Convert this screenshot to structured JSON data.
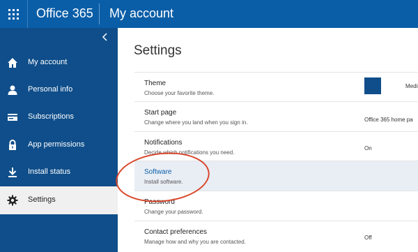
{
  "topbar": {
    "brand": "Office 365",
    "page": "My account",
    "accent": "#0a5ea8"
  },
  "sidebar": {
    "collapse_icon": "chevron-left-icon",
    "items": [
      {
        "label": "My account",
        "icon": "home-icon"
      },
      {
        "label": "Personal info",
        "icon": "person-icon"
      },
      {
        "label": "Subscriptions",
        "icon": "card-icon"
      },
      {
        "label": "App permissions",
        "icon": "lock-icon"
      },
      {
        "label": "Install status",
        "icon": "download-icon"
      },
      {
        "label": "Settings",
        "icon": "gear-icon",
        "active": true
      }
    ]
  },
  "main": {
    "title": "Settings",
    "rows": [
      {
        "name": "Theme",
        "desc": "Choose your favorite theme.",
        "value": "Medium D"
      },
      {
        "name": "Start page",
        "desc": "Change where you land when you sign in.",
        "value": "Office 365 home pa"
      },
      {
        "name": "Notifications",
        "desc": "Decide which notifications you need.",
        "value": "On"
      },
      {
        "name": "Software",
        "desc": "Install software.",
        "value": ""
      },
      {
        "name": "Password",
        "desc": "Change your password.",
        "value": ""
      },
      {
        "name": "Contact preferences",
        "desc": "Manage how and why you are contacted.",
        "value": "Off"
      }
    ]
  },
  "colors": {
    "sidebar": "#0f4e8a",
    "highlight_row": "#e9eef5",
    "annotation": "#d9462a"
  }
}
